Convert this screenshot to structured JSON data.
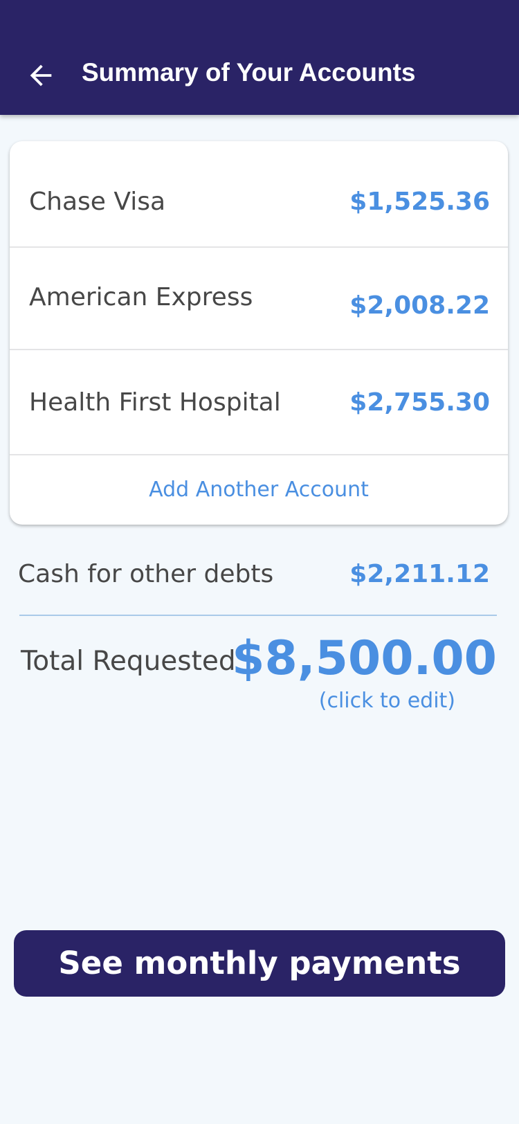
{
  "header": {
    "title": "Summary of Your Accounts",
    "back_icon": "arrow-left-icon"
  },
  "accounts": [
    {
      "name": "Chase Visa",
      "amount": "$1,525.36"
    },
    {
      "name": "American Express",
      "amount": "$2,008.22"
    },
    {
      "name": "Health First Hospital",
      "amount": "$2,755.30"
    }
  ],
  "add_account_label": "Add Another Account",
  "cash": {
    "label": "Cash for other debts",
    "amount": "$2,211.12"
  },
  "total": {
    "label": "Total Requested",
    "amount": "$8,500.00",
    "edit_hint": "(click to edit)"
  },
  "primary_button_label": "See monthly payments",
  "colors": {
    "brand": "#2a2366",
    "accent": "#4a8fe1",
    "background": "#f3f8fc",
    "text": "#474747"
  }
}
